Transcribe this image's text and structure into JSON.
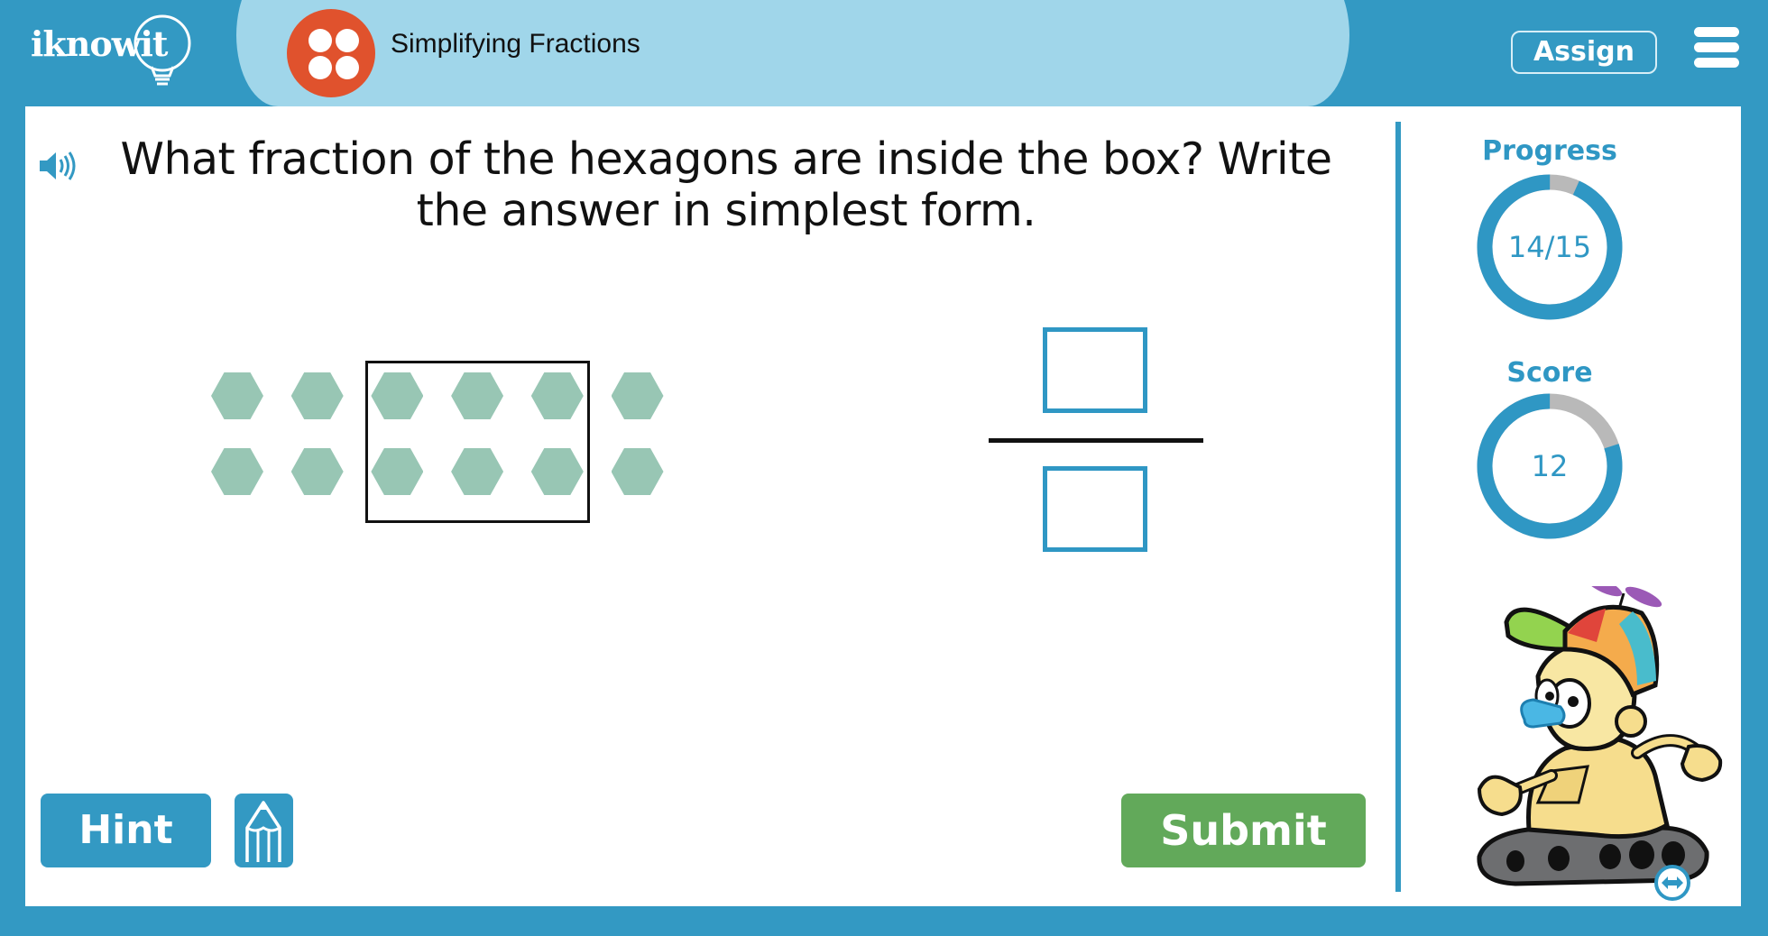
{
  "header": {
    "logo_text": "iknowit",
    "topic_title": "Simplifying Fractions",
    "assign_label": "Assign",
    "icons": {
      "logo": "lightbulb-logo-icon",
      "topic": "four-dots-icon",
      "menu": "hamburger-menu-icon"
    }
  },
  "question": {
    "text": "What fraction of the hexagons are inside the box? Write the answer in simplest form.",
    "speaker_icon": "speaker-icon"
  },
  "figure": {
    "shape": "hexagon",
    "rows": 2,
    "columns": 6,
    "total": 12,
    "inside_box": 6,
    "box_columns": [
      3,
      4,
      5
    ],
    "hexagon_color": "#98c6b4"
  },
  "answer": {
    "numerator": "",
    "denominator": "",
    "box_color": "#2f97c4"
  },
  "buttons": {
    "hint_label": "Hint",
    "submit_label": "Submit",
    "pencil_icon": "pencil-icon"
  },
  "stats": {
    "progress_label": "Progress",
    "progress_text": "14/15",
    "progress_fraction": 0.9333,
    "score_label": "Score",
    "score_text": "12",
    "score_fraction": 0.8
  },
  "colors": {
    "brand": "#3399c3",
    "banner": "#a0d6ea",
    "topic_icon": "#e0522d",
    "submit": "#62a95a",
    "ring_track": "#b9b9b9"
  },
  "mascot": {
    "name": "robot-mascot",
    "swap_icon": "swap-arrows-icon"
  }
}
